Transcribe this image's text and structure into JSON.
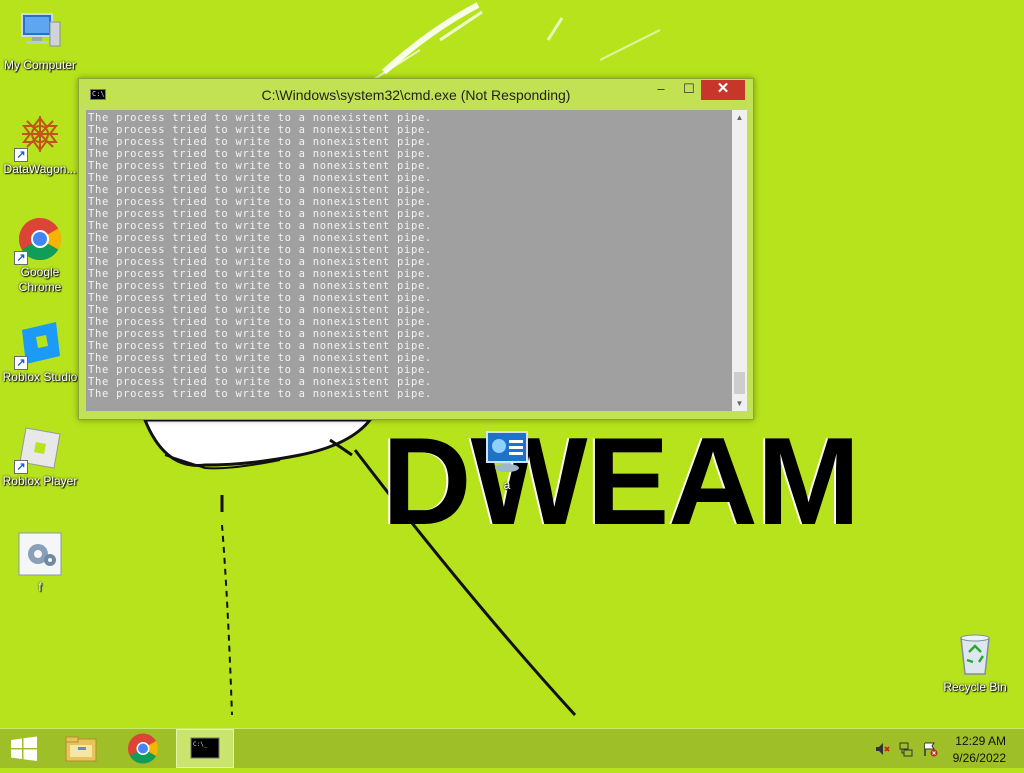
{
  "wallpaper": {
    "text": "DWEAM",
    "background_color": "#b6e31c"
  },
  "desktop_icons": [
    {
      "label": "My Computer",
      "icon": "computer-icon",
      "shortcut": false
    },
    {
      "label": "DataWagon...",
      "icon": "datawagon-icon",
      "shortcut": true
    },
    {
      "label": "Google Chrome",
      "icon": "chrome-icon",
      "shortcut": true
    },
    {
      "label": "Roblox Studio",
      "icon": "roblox-studio-icon",
      "shortcut": true
    },
    {
      "label": "Roblox Player",
      "icon": "roblox-player-icon",
      "shortcut": true
    },
    {
      "label": "f",
      "icon": "settings-file-icon",
      "shortcut": false
    },
    {
      "label": "a",
      "icon": "control-panel-icon",
      "shortcut": false
    },
    {
      "label": "Recycle Bin",
      "icon": "recycle-bin-icon",
      "shortcut": false
    }
  ],
  "cmd_window": {
    "title": "C:\\Windows\\system32\\cmd.exe (Not Responding)",
    "minimize_label": "–",
    "maximize_label": "☐",
    "close_label": "✕",
    "console_background": "#a0a0a0",
    "line_text": "The process tried to write to a nonexistent pipe.",
    "line_count": 24,
    "scroll_up": "▲",
    "scroll_down": "▼"
  },
  "taskbar": {
    "items": [
      {
        "name": "start",
        "icon": "windows-logo-icon",
        "active": false
      },
      {
        "name": "file-explorer",
        "icon": "file-explorer-icon",
        "active": false
      },
      {
        "name": "chrome",
        "icon": "chrome-icon",
        "active": false
      },
      {
        "name": "cmd",
        "icon": "cmd-icon",
        "active": true
      }
    ],
    "tray": {
      "icons": [
        "volume-muted-icon",
        "network-icon",
        "action-center-flag-icon"
      ],
      "time": "12:29 AM",
      "date": "9/26/2022"
    }
  }
}
